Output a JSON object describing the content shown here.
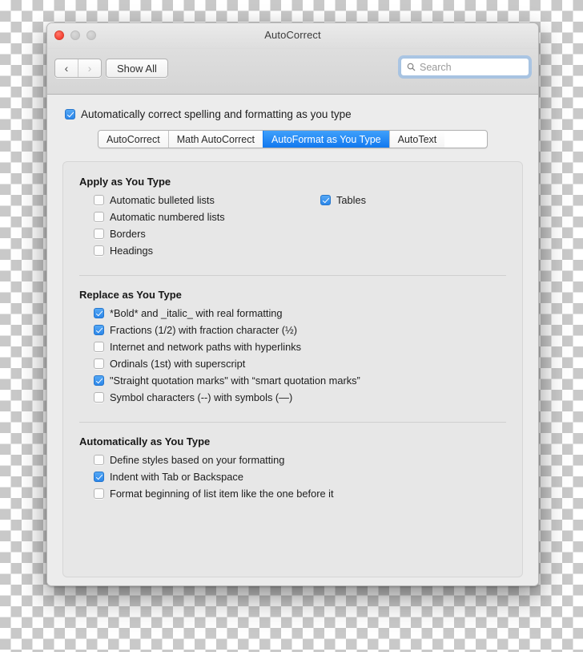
{
  "window": {
    "title": "AutoCorrect",
    "traffic_lights": [
      "close",
      "minimize",
      "zoom"
    ]
  },
  "toolbar": {
    "back_label": "‹",
    "forward_label": "›",
    "show_all_label": "Show All",
    "search": {
      "value": "",
      "placeholder": "Search",
      "icon": "search-icon"
    }
  },
  "master": {
    "label": "Automatically correct spelling and formatting as you type",
    "checked": true
  },
  "tabs": [
    {
      "label": "AutoCorrect",
      "active": false
    },
    {
      "label": "Math AutoCorrect",
      "active": false
    },
    {
      "label": "AutoFormat as You Type",
      "active": true
    },
    {
      "label": "AutoText",
      "active": false
    }
  ],
  "sections": [
    {
      "title": "Apply as You Type",
      "left_options": [
        {
          "label": "Automatic bulleted lists",
          "checked": false
        },
        {
          "label": "Automatic numbered lists",
          "checked": false
        },
        {
          "label": "Borders",
          "checked": false
        },
        {
          "label": "Headings",
          "checked": false
        }
      ],
      "right_options": [
        {
          "label": "Tables",
          "checked": true
        }
      ]
    },
    {
      "title": "Replace as You Type",
      "left_options": [
        {
          "label": "*Bold* and _italic_ with real formatting",
          "checked": true
        },
        {
          "label": "Fractions (1/2) with fraction character (½)",
          "checked": true
        },
        {
          "label": "Internet and network paths with hyperlinks",
          "checked": false
        },
        {
          "label": "Ordinals (1st) with superscript",
          "checked": false
        },
        {
          "label": "\"Straight quotation marks\" with “smart quotation marks”",
          "checked": true
        },
        {
          "label": "Symbol characters (--) with symbols (—)",
          "checked": false
        }
      ],
      "right_options": []
    },
    {
      "title": "Automatically as You Type",
      "left_options": [
        {
          "label": "Define styles based on your formatting",
          "checked": false
        },
        {
          "label": "Indent with Tab or Backspace",
          "checked": true
        },
        {
          "label": "Format beginning of list item like the one before it",
          "checked": false
        }
      ],
      "right_options": []
    }
  ],
  "colors": {
    "accent_blue": "#1178ef",
    "checkbox_blue": "#2b86ea",
    "close_red": "#f8483a",
    "window_bg": "#ececec",
    "panel_bg": "#e7e7e7"
  }
}
